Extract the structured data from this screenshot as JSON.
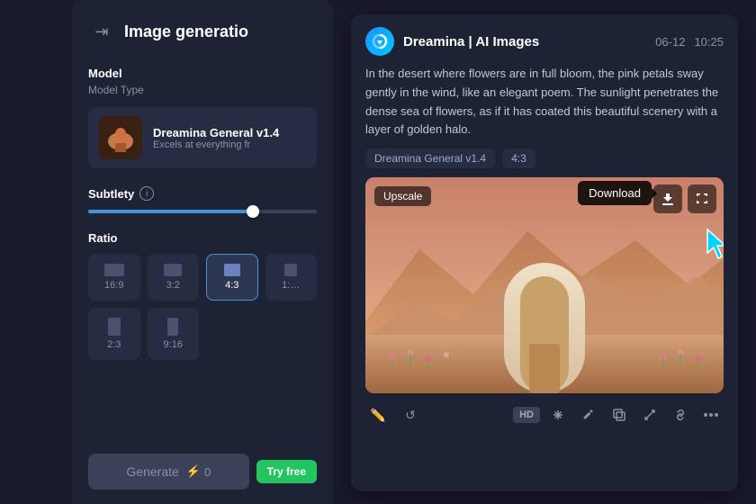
{
  "leftPanel": {
    "title": "Image generatio",
    "model": {
      "label": "Model",
      "sublabel": "Model Type",
      "name": "Dreamina General v1.4",
      "desc": "Excels at everything fr"
    },
    "subtlety": {
      "label": "Subtlety",
      "sliderValue": 72
    },
    "ratio": {
      "label": "Ratio",
      "options": [
        {
          "id": "16_9",
          "label": "16:9",
          "w": 22,
          "h": 14
        },
        {
          "id": "3_2",
          "label": "3:2",
          "w": 20,
          "h": 14
        },
        {
          "id": "4_3",
          "label": "4:3",
          "w": 18,
          "h": 14,
          "active": true
        },
        {
          "id": "1_1",
          "label": "1:…",
          "w": 14,
          "h": 14
        },
        {
          "id": "2_3",
          "label": "2:3",
          "w": 14,
          "h": 20
        },
        {
          "id": "9_16",
          "label": "9:16",
          "w": 12,
          "h": 22
        }
      ]
    },
    "generateButton": {
      "label": "Generate",
      "count": "0",
      "tryFreeLabel": "Try free"
    }
  },
  "rightPanel": {
    "appIcon": "⬇",
    "appName": "Dreamina | AI Images",
    "date": "06-12",
    "time": "10:25",
    "description": "In the desert where flowers are in full bloom, the pink petals sway gently in the wind, like an elegant poem. The sunlight penetrates the dense sea of flowers, as if it has coated this beautiful scenery with a layer of golden halo.",
    "tags": [
      {
        "label": "Dreamina General v1.4"
      },
      {
        "label": "4:3"
      }
    ],
    "imageOverlay": {
      "upscaleLabel": "Upscale",
      "downloadTooltip": "Download"
    },
    "toolbar": {
      "hdLabel": "HD",
      "icons": [
        "✏️",
        "🔄",
        "⬆",
        "✂️",
        "📋",
        "⤢",
        "🔗",
        "⋯"
      ]
    }
  }
}
